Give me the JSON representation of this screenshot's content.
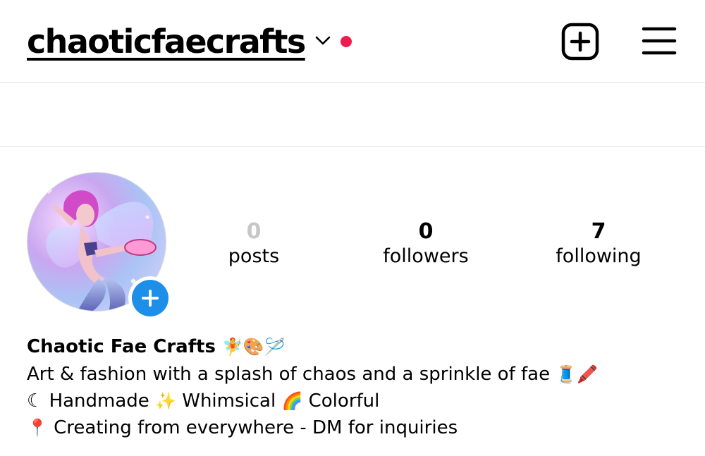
{
  "header": {
    "username": "chaoticfaecrafts",
    "icons": {
      "dropdown": "chevron-down-icon",
      "notification": "notification-dot",
      "new_post": "plus-square-icon",
      "menu": "hamburger-menu-icon"
    },
    "notification_color": "#ee1d4f"
  },
  "profile": {
    "avatar": "fairy-illustration-avatar",
    "add_story_color": "#1d8fe8",
    "stats": [
      {
        "value": "0",
        "label": "posts"
      },
      {
        "value": "0",
        "label": "followers"
      },
      {
        "value": "7",
        "label": "following"
      }
    ],
    "bio": {
      "name": "Chaotic Fae Crafts",
      "name_emojis": "🧚🎨🪡",
      "line1_text": "Art & fashion with a splash of chaos and a sprinkle of fae",
      "line1_emojis": "🧵🖍️",
      "line2_moon": "☾",
      "line2_a": "Handmade",
      "line2_sparkle": "✨",
      "line2_b": "Whimsical",
      "line2_rainbow": "🌈",
      "line2_c": "Colorful",
      "line3_pin": "📍",
      "line3_text": "Creating from everywhere - DM for inquiries"
    }
  }
}
